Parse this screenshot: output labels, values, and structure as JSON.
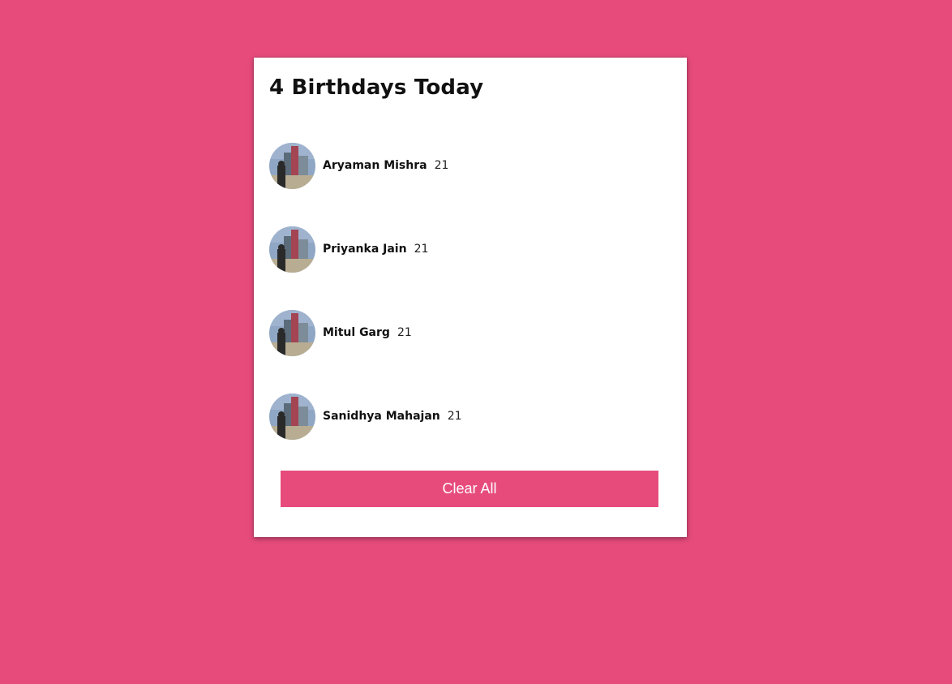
{
  "header": {
    "title": "4 Birthdays Today"
  },
  "people": [
    {
      "name": "Aryaman Mishra",
      "age": "21"
    },
    {
      "name": "Priyanka Jain",
      "age": "21"
    },
    {
      "name": "Mitul Garg",
      "age": "21"
    },
    {
      "name": "Sanidhya Mahajan",
      "age": "21"
    }
  ],
  "actions": {
    "clear_label": "Clear All"
  },
  "colors": {
    "background": "#e64b7c",
    "button": "#e64b7c",
    "card": "#ffffff"
  }
}
